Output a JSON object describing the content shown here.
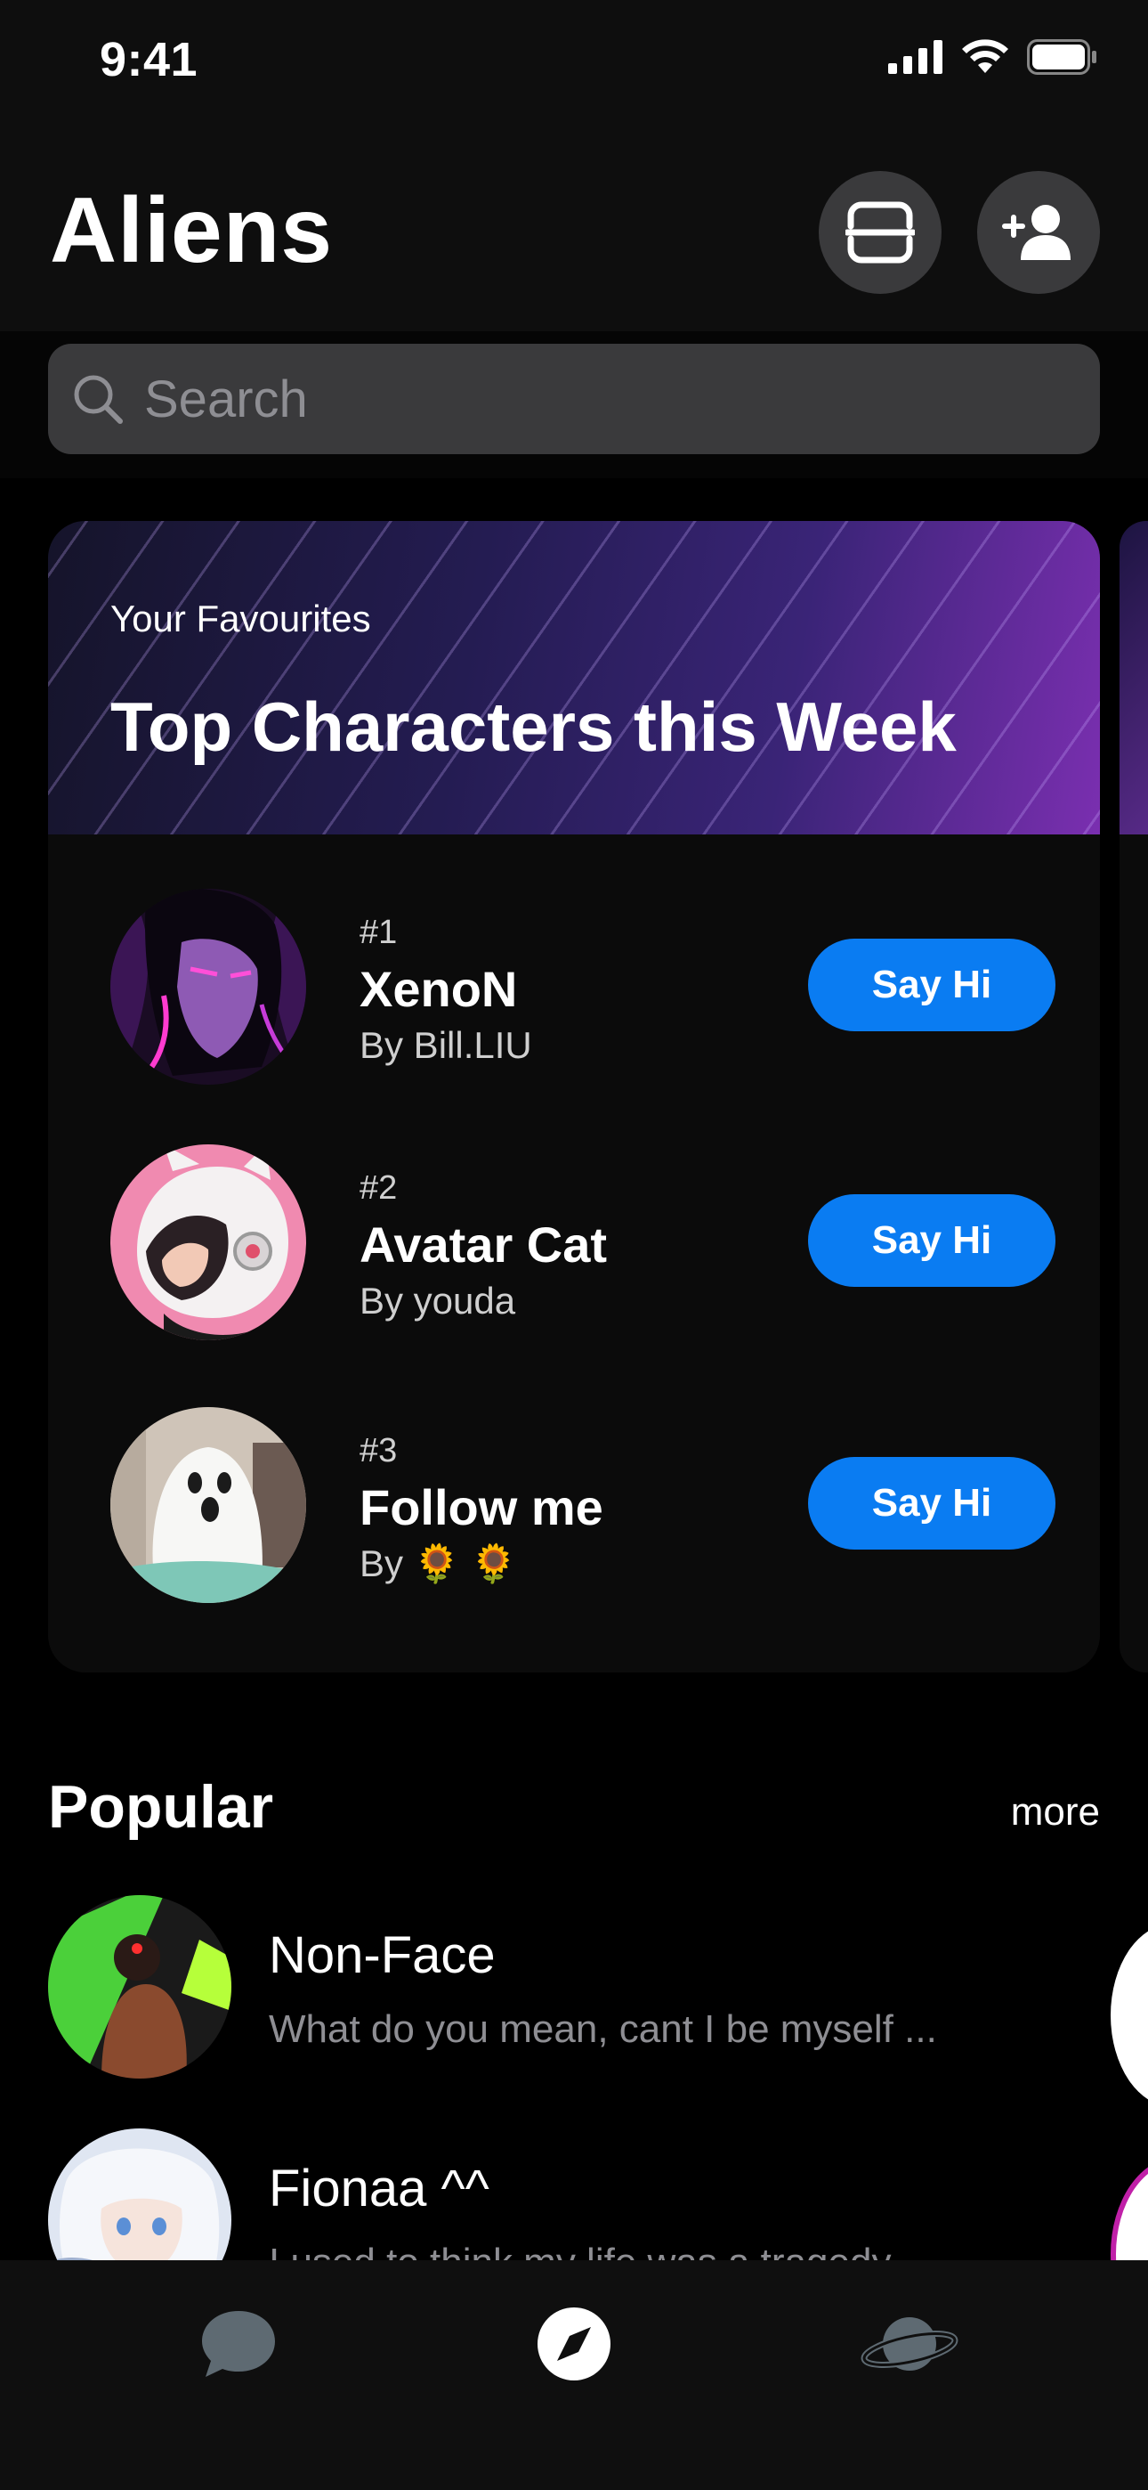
{
  "status_bar": {
    "time": "9:41"
  },
  "header": {
    "title": "Aliens",
    "scan_button_icon": "scan-frame-icon",
    "add_friend_button_icon": "add-person-icon"
  },
  "search": {
    "placeholder": "Search"
  },
  "featured": {
    "subtitle": "Your Favourites",
    "title": "Top Characters this Week",
    "items": [
      {
        "rank": "#1",
        "name": "XenoN",
        "by": "By  Bill.LIU",
        "button": "Say Hi"
      },
      {
        "rank": "#2",
        "name": "Avatar Cat",
        "by": "By  youda",
        "button": "Say Hi"
      },
      {
        "rank": "#3",
        "name": "Follow me",
        "by": "By  🌻 🌻",
        "button": "Say Hi"
      }
    ]
  },
  "popular": {
    "title": "Popular",
    "more": "more",
    "items": [
      {
        "name": "Non-Face",
        "message": "What do you mean, cant I be myself ..."
      },
      {
        "name": "Fionaa ^^",
        "message": "I used to think my life was a tragedy..."
      }
    ]
  },
  "tabbar": {
    "tabs": [
      {
        "icon": "chat-bubble-icon",
        "active": false
      },
      {
        "icon": "compass-icon",
        "active": true
      },
      {
        "icon": "planet-icon",
        "active": false
      }
    ]
  },
  "colors": {
    "accent": "#0a7cf2",
    "background": "#000000",
    "secondary_text": "#8e8e93"
  }
}
